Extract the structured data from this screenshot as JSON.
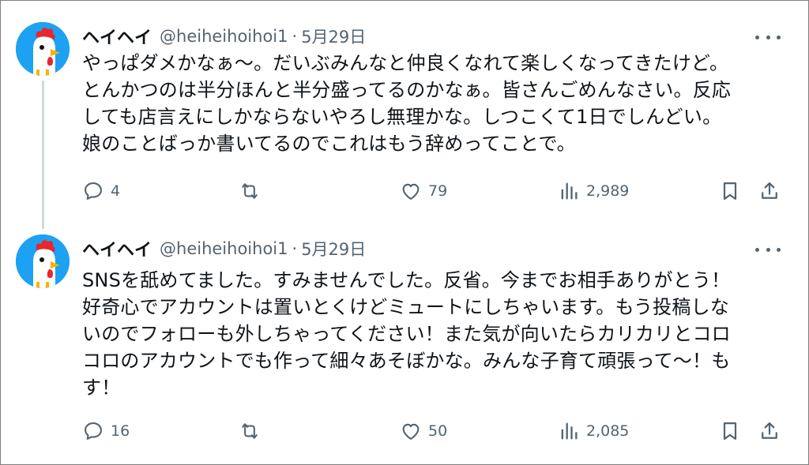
{
  "tweets": [
    {
      "author_name": "ヘイヘイ",
      "handle": "@heiheihoihoi1",
      "separator": "·",
      "date": "5月29日",
      "text": "やっぱダメかなぁ～。だいぶみんなと仲良くなれて楽しくなってきたけど。\nとんかつのは半分ほんと半分盛ってるのかなぁ。皆さんごめんなさい。反応\nしても店言えにしかならないやろし無理かな。しつこくて1日でしんどい。\n娘のことばっか書いてるのでこれはもう辞めってことで。",
      "reply_count": "4",
      "retweet_count": "",
      "like_count": "79",
      "view_count": "2,989"
    },
    {
      "author_name": "ヘイヘイ",
      "handle": "@heiheihoihoi1",
      "separator": "·",
      "date": "5月29日",
      "text": "SNSを舐めてました。すみませんでした。反省。今までお相手ありがとう！\n好奇心でアカウントは置いとくけどミュートにしちゃいます。もう投稿しな\nいのでフォローも外しちゃってください！また気が向いたらカリカリとコロ\nコロのアカウントでも作って細々あそぼかな。みんな子育て頑張って～！も\nす！",
      "reply_count": "16",
      "retweet_count": "",
      "like_count": "50",
      "view_count": "2,085"
    }
  ],
  "icons": {
    "reply": "speech-bubble-icon",
    "retweet": "retweet-icon",
    "like": "heart-icon",
    "views": "bar-chart-icon",
    "bookmark": "bookmark-icon",
    "share": "share-icon",
    "more": "ellipsis-icon"
  },
  "colors": {
    "text": "#0f1419",
    "secondary": "#536471",
    "thread_line": "#cfd9de",
    "avatar_bg": "#1da1f2"
  }
}
